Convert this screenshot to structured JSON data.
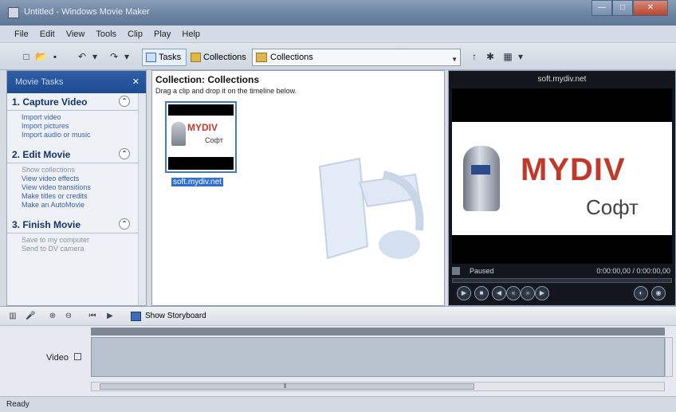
{
  "window": {
    "title": "Untitled - Windows Movie Maker",
    "minimize": "—",
    "maximize": "□",
    "close": "✕"
  },
  "menu": [
    "File",
    "Edit",
    "View",
    "Tools",
    "Clip",
    "Play",
    "Help"
  ],
  "toolbar": {
    "tasks_label": "Tasks",
    "collections_label": "Collections",
    "collections_combo_value": "Collections"
  },
  "tasks": {
    "header": "Movie Tasks",
    "close": "✕",
    "sections": [
      {
        "title": "1. Capture Video",
        "links": [
          "Import video",
          "Import pictures",
          "Import audio or music"
        ]
      },
      {
        "title": "2. Edit Movie",
        "links": [
          "Show collections",
          "View video effects",
          "View video transitions",
          "Make titles or credits",
          "Make an AutoMovie"
        ]
      },
      {
        "title": "3. Finish Movie",
        "links": [
          "Save to my computer",
          "Send to DV camera"
        ]
      }
    ]
  },
  "collection": {
    "title": "Collection: Collections",
    "subtitle": "Drag a clip and drop it on the timeline below.",
    "clip": {
      "label": "soft.mydiv.net",
      "thumb_logo": "MYDIV",
      "thumb_text": "Софт"
    }
  },
  "monitor": {
    "title": "soft.mydiv.net",
    "logo": "MYDIV",
    "logo_sub": "Софт",
    "state": "Paused",
    "time": "0:00:00,00 / 0:00:00,00"
  },
  "timeline": {
    "storyboard_label": "Show Storyboard",
    "video_label": "Video"
  },
  "status": {
    "text": "Ready"
  },
  "colors": {
    "accent": "#2f6fd1",
    "logo_red": "#c0392b",
    "task_header": "#1d4c92"
  }
}
